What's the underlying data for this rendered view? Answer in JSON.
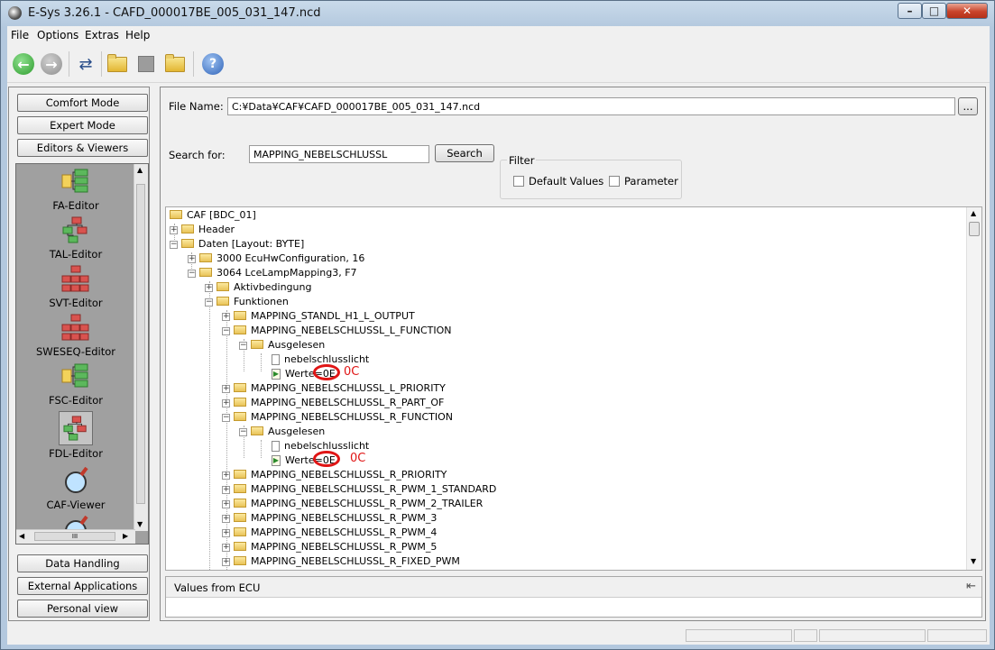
{
  "window": {
    "title": "E-Sys 3.26.1 - CAFD_000017BE_005_031_147.ncd"
  },
  "menu": [
    "File",
    "Options",
    "Extras",
    "Help"
  ],
  "left": {
    "modes": [
      "Comfort Mode",
      "Expert Mode",
      "Editors & Viewers"
    ],
    "editors": [
      "FA-Editor",
      "TAL-Editor",
      "SVT-Editor",
      "SWESEQ-Editor",
      "FSC-Editor",
      "FDL-Editor",
      "CAF-Viewer"
    ],
    "bottom_buttons": [
      "Data Handling",
      "External Applications",
      "Personal view"
    ],
    "hscroll_label": "III"
  },
  "form": {
    "file_label": "File Name:",
    "file_value": "C:¥Data¥CAF¥CAFD_000017BE_005_031_147.ncd",
    "browse": "...",
    "search_label": "Search for:",
    "search_value": "MAPPING_NEBELSCHLUSSL",
    "search_button": "Search",
    "filter_title": "Filter",
    "default_values": "Default Values",
    "parameter": "Parameter"
  },
  "tree": {
    "root": "CAF [BDC_01]",
    "header": "Header",
    "daten": "Daten [Layout: BYTE]",
    "n3000": "3000 EcuHwConfiguration, 16",
    "n3064": "3064 LceLampMapping3, F7",
    "aktiv": "Aktivbedingung",
    "funktionen": "Funktionen",
    "f1": "MAPPING_STANDL_H1_L_OUTPUT",
    "f2": "MAPPING_NEBELSCHLUSSL_L_FUNCTION",
    "ausgelesen1": "Ausgelesen",
    "nebel1": "nebelschlusslicht",
    "werte1": "Werte=0E",
    "f3": "MAPPING_NEBELSCHLUSSL_L_PRIORITY",
    "f4": "MAPPING_NEBELSCHLUSSL_R_PART_OF",
    "f5": "MAPPING_NEBELSCHLUSSL_R_FUNCTION",
    "ausgelesen2": "Ausgelesen",
    "nebel2": "nebelschlusslicht",
    "werte2": "Werte=0E",
    "f6": "MAPPING_NEBELSCHLUSSL_R_PRIORITY",
    "f7": "MAPPING_NEBELSCHLUSSL_R_PWM_1_STANDARD",
    "f8": "MAPPING_NEBELSCHLUSSL_R_PWM_2_TRAILER",
    "f9": "MAPPING_NEBELSCHLUSSL_R_PWM_3",
    "f10": "MAPPING_NEBELSCHLUSSL_R_PWM_4",
    "f11": "MAPPING_NEBELSCHLUSSL_R_PWM_5",
    "f12": "MAPPING_NEBELSCHLUSSL_R_FIXED_PWM"
  },
  "annotations": {
    "first": "0C",
    "second": "0C",
    "color": "#e01515"
  },
  "values_panel": {
    "title": "Values from ECU"
  }
}
